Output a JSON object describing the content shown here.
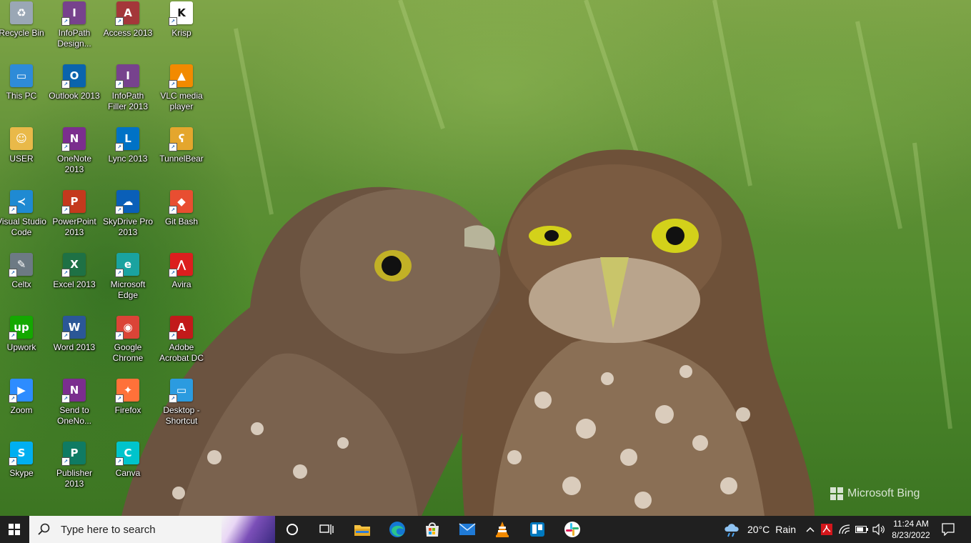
{
  "wallpaper": {
    "description_brand": "Microsoft Bing"
  },
  "desktop": {
    "icons": [
      {
        "label": "Recycle Bin",
        "icon": "recycle-bin-icon",
        "color": "#9aa7b5"
      },
      {
        "label": "This PC",
        "icon": "this-pc-icon",
        "color": "#2e8bd8"
      },
      {
        "label": "USER",
        "icon": "user-folder-icon",
        "color": "#e9b949"
      },
      {
        "label": "Visual Studio\nCode",
        "icon": "vscode-icon",
        "color": "#1f8ad2"
      },
      {
        "label": "Celtx",
        "icon": "celtx-icon",
        "color": "#6d7a84"
      },
      {
        "label": "Upwork",
        "icon": "upwork-icon",
        "color": "#14a800"
      },
      {
        "label": "Zoom",
        "icon": "zoom-icon",
        "color": "#2d8cff"
      },
      {
        "label": "Skype",
        "icon": "skype-icon",
        "color": "#00aff0"
      },
      {
        "label": "InfoPath\nDesign...",
        "icon": "infopath-designer-icon",
        "color": "#77428d"
      },
      {
        "label": "Outlook 2013",
        "icon": "outlook-icon",
        "color": "#0a64ad"
      },
      {
        "label": "OneNote\n2013",
        "icon": "onenote-icon",
        "color": "#7b2e8e"
      },
      {
        "label": "PowerPoint\n2013",
        "icon": "powerpoint-icon",
        "color": "#c4391d"
      },
      {
        "label": "Excel 2013",
        "icon": "excel-icon",
        "color": "#1e7145"
      },
      {
        "label": "Word 2013",
        "icon": "word-icon",
        "color": "#2b5797"
      },
      {
        "label": "Send to\nOneNo...",
        "icon": "send-to-onenote-icon",
        "color": "#7b2e8e"
      },
      {
        "label": "Publisher\n2013",
        "icon": "publisher-icon",
        "color": "#0f7b63"
      },
      {
        "label": "Access 2013",
        "icon": "access-icon",
        "color": "#a4373a"
      },
      {
        "label": "InfoPath\nFiller 2013",
        "icon": "infopath-filler-icon",
        "color": "#77428d"
      },
      {
        "label": "Lync 2013",
        "icon": "lync-icon",
        "color": "#0072c6"
      },
      {
        "label": "SkyDrive Pro\n2013",
        "icon": "skydrive-icon",
        "color": "#0a5fb8"
      },
      {
        "label": "Microsoft\nEdge",
        "icon": "edge-icon",
        "color": "#1aa3a0"
      },
      {
        "label": "Google\nChrome",
        "icon": "chrome-icon",
        "color": "#db4437"
      },
      {
        "label": "Firefox",
        "icon": "firefox-icon",
        "color": "#ff7139"
      },
      {
        "label": "Canva",
        "icon": "canva-icon",
        "color": "#00c4cc"
      },
      {
        "label": "Krisp",
        "icon": "krisp-icon",
        "color": "#ffffff"
      },
      {
        "label": "VLC media\nplayer",
        "icon": "vlc-icon",
        "color": "#f28a00"
      },
      {
        "label": "TunnelBear",
        "icon": "tunnelbear-icon",
        "color": "#e4a62d"
      },
      {
        "label": "Git Bash",
        "icon": "git-bash-icon",
        "color": "#e84e31"
      },
      {
        "label": "Avira",
        "icon": "avira-icon",
        "color": "#dc1e1e"
      },
      {
        "label": "Adobe\nAcrobat DC",
        "icon": "acrobat-icon",
        "color": "#c21a1a"
      },
      {
        "label": "Desktop -\nShortcut",
        "icon": "desktop-shortcut-icon",
        "color": "#2b9be0"
      }
    ]
  },
  "taskbar": {
    "search_placeholder": "Type here to search",
    "pinned_apps": [
      {
        "name": "task-view",
        "icon": "task-view-icon"
      },
      {
        "name": "file-explorer",
        "icon": "folder-icon"
      },
      {
        "name": "edge",
        "icon": "edge-icon"
      },
      {
        "name": "microsoft-store",
        "icon": "store-icon"
      },
      {
        "name": "mail",
        "icon": "mail-icon"
      },
      {
        "name": "vlc",
        "icon": "vlc-icon"
      },
      {
        "name": "trello",
        "icon": "trello-icon"
      },
      {
        "name": "slack",
        "icon": "slack-icon"
      }
    ],
    "weather": {
      "temp": "20°C",
      "condition": "Rain"
    },
    "clock": {
      "time": "11:24 AM",
      "date": "8/23/2022"
    }
  }
}
